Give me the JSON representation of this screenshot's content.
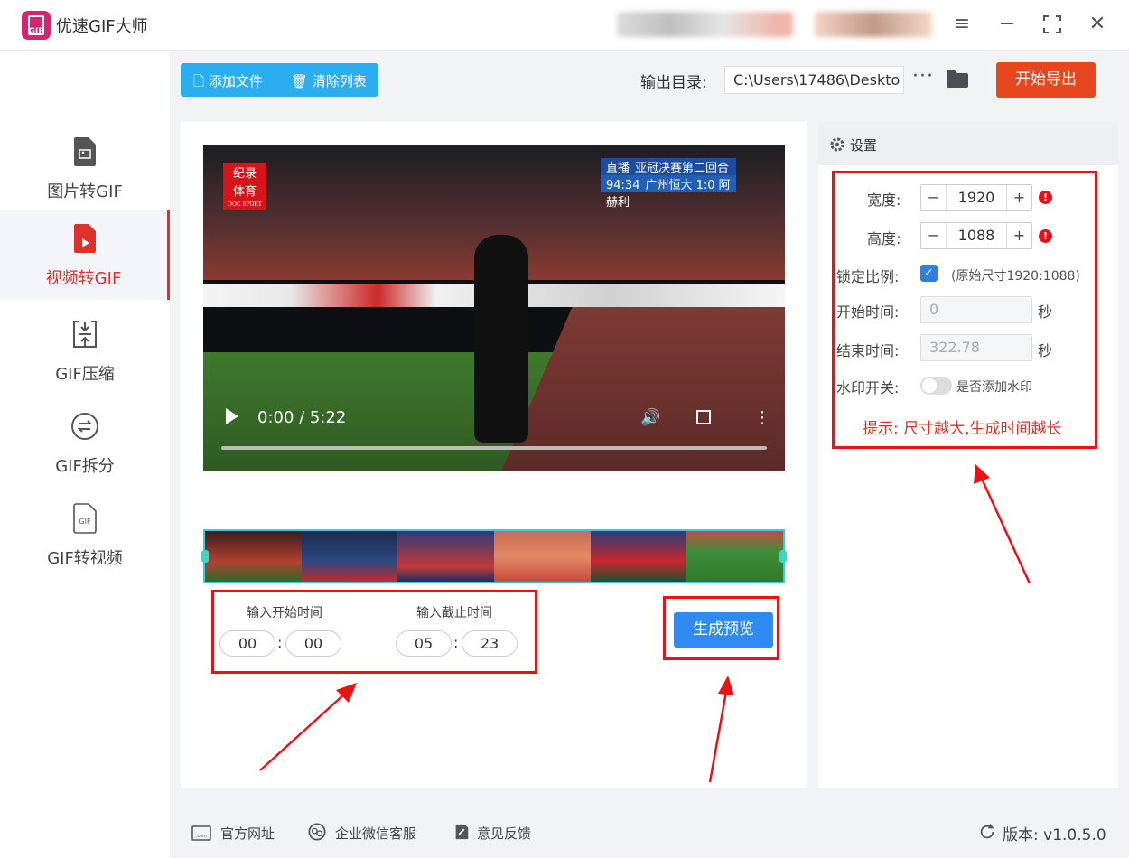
{
  "app": {
    "title": "优速GIF大师",
    "logo_text": "GIF"
  },
  "window_controls": [
    "menu-icon",
    "minimize-icon",
    "maximize-icon",
    "close-icon"
  ],
  "sidebar": {
    "items": [
      {
        "label": "图片转GIF",
        "icon": "image-file-icon",
        "active": false
      },
      {
        "label": "视频转GIF",
        "icon": "video-file-icon",
        "active": true
      },
      {
        "label": "GIF压缩",
        "icon": "compress-icon",
        "active": false
      },
      {
        "label": "GIF拆分",
        "icon": "split-icon",
        "active": false
      },
      {
        "label": "GIF转视频",
        "icon": "gif-file-icon",
        "active": false
      }
    ]
  },
  "toolbar": {
    "add_file": "添加文件",
    "clear_list": "清除列表",
    "output_label": "输出目录:",
    "output_path": "C:\\Users\\17486\\Deskto",
    "more": "···",
    "export": "开始导出"
  },
  "video": {
    "time": "0:00 / 5:22",
    "overlay_logo": [
      "纪录",
      "体育",
      "DOC SPORT"
    ],
    "live_label": "直播",
    "live_title": "亚冠决赛第二回合",
    "live_clock": "94:34",
    "live_score": "广州恒大 1:0 阿赫利",
    "progress": 0
  },
  "trim": {
    "start_label": "输入开始时间",
    "end_label": "输入截止时间",
    "start_min": "00",
    "start_sec": "00",
    "end_min": "05",
    "end_sec": "23",
    "separator": ":",
    "preview_button": "生成预览"
  },
  "settings": {
    "title": "设置",
    "width_label": "宽度:",
    "width_value": "1920",
    "height_label": "高度:",
    "height_value": "1088",
    "lock_label": "锁定比例:",
    "lock_checked": true,
    "original_size": "(原始尺寸1920:1088)",
    "start_label": "开始时间:",
    "start_value": "0",
    "end_label": "结束时间:",
    "end_value": "322.78",
    "seconds_unit": "秒",
    "watermark_label": "水印开关:",
    "watermark_text": "是否添加水印",
    "watermark_on": false,
    "hint": "提示: 尺寸越大,生成时间越长",
    "minus": "−",
    "plus": "+",
    "warn": "!"
  },
  "footer": {
    "website": "官方网址",
    "wechat": "企业微信客服",
    "feedback": "意见反馈",
    "version": "版本: v1.0.5.0"
  },
  "colors": {
    "accent_blue": "#2aaef0",
    "export_orange": "#e8461d",
    "active_red": "#e0302a",
    "preview_blue": "#2f8af2",
    "annotation_red": "#ee1111"
  }
}
